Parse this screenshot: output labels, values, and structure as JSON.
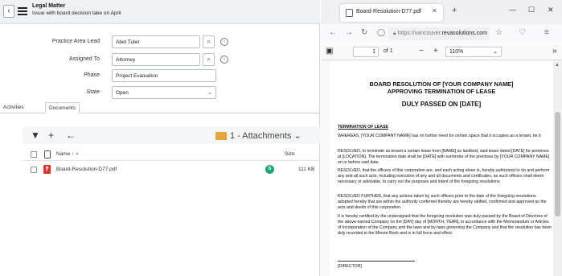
{
  "app": {
    "record_type": "Legal Matter",
    "record_title": "Issue with board decision take on April",
    "form": {
      "practice_area_lead": {
        "label": "Practice Area Lead",
        "value": "Abel Tuter"
      },
      "assigned_to": {
        "label": "Assigned To",
        "value": "Attorney"
      },
      "phase": {
        "label": "Phase",
        "value": "Project Evaluation"
      },
      "state": {
        "label": "State",
        "value": "Open"
      }
    },
    "tabs": [
      {
        "label": "Activities"
      },
      {
        "label": "Documents",
        "active": true
      }
    ],
    "documents": {
      "folder": "1 - Attachments",
      "columns": {
        "name": "Name ↑",
        "size": "Size"
      },
      "rows": [
        {
          "name": "Board-Resolution-D77.pdf",
          "size": "111 KB"
        }
      ]
    }
  },
  "browser": {
    "tab_title": "Board-Resolution-D77.pdf",
    "url_prefix": "https://vancouver.",
    "url_domain": "revasolutions.com",
    "pdf_toolbar": {
      "page": "1",
      "of": "of 1",
      "zoom": "110%"
    },
    "pdf": {
      "title_line1": "BOARD RESOLUTION OF [YOUR COMPANY NAME]",
      "title_line2": "APPROVING TERMINATION OF LEASE",
      "title_line3": "DULY PASSED ON [DATE]",
      "heading": "TERMINATION OF LEASE",
      "p1": "WHEREAS, [YOUR COMPANY NAME] has no further need for certain space that it occupies as a tenant, be it",
      "p2": "RESOLVED, to terminate as tenant a certain lease from [NAME] as landlord, said lease dated [DATE] for premises at [LOCATION]. The termination date shall be [DATE] with surrender of the premises by [YOUR COMPANY NAME] on or before said date.",
      "p3": "RESOLVED, that the officers of this corporation are, and each acting alone is, hereby authorized to do and perform any and all such acts, including execution of any and all documents and certificates, as such officers shall deem necessary or advisable, to carry out the purposes and intent of the foregoing resolutions.",
      "p4": "RESOLVED FURTHER, that any actions taken by such officers prior to the date of the foregoing resolutions adopted hereby that are within the authority conferred thereby are hereby ratified, confirmed and approved as the acts and deeds of this corporation.",
      "p5": "It is hereby certified by the undersigned that the foregoing resolution was duly passed by the Board of Directors of the above-named Company on the [DAY] day of [MONTH, YEAR], in accordance with the Memorandum or Articles of Incorporation of the Company and the laws and by-laws governing the Company and that the resolution has been duly recorded in the Minute Book and is in full force and effect.",
      "signature": "[DIRECTOR]"
    }
  },
  "colors": {
    "folder": "#e8a33a",
    "pdf_icon": "#d9332b",
    "badge": "#1fa37a"
  }
}
